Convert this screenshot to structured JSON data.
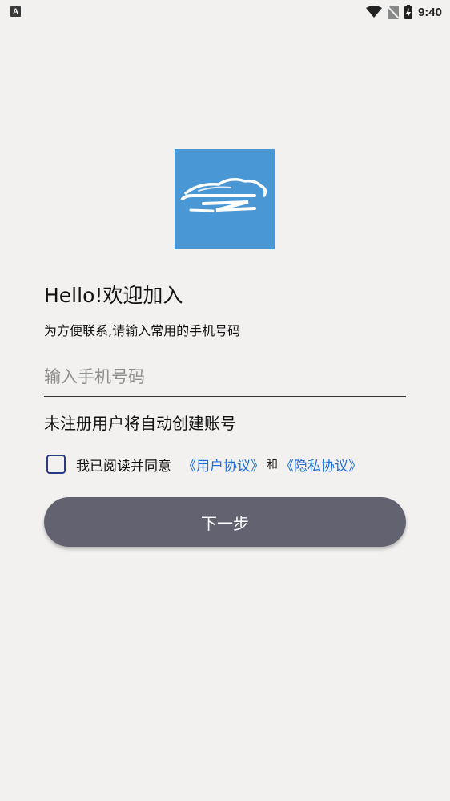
{
  "status_bar": {
    "notification_icon_letter": "A",
    "time": "9:40",
    "icons": [
      "wifi-icon",
      "no-sim-icon",
      "battery-charging-icon"
    ]
  },
  "logo": {
    "icon": "cloud-logo-icon",
    "background_color": "#4a97d6"
  },
  "header": {
    "title": "Hello!欢迎加入",
    "subtitle": "为方便联系,请输入常用的手机号码"
  },
  "form": {
    "phone_value": "",
    "phone_placeholder": "输入手机号码",
    "notice": "未注册用户将自动创建账号",
    "agreement": {
      "checked": false,
      "prefix": "我已阅读并同意",
      "user_agreement": "《用户协议》",
      "conjunction": "和",
      "privacy_policy": "《隐私协议》",
      "link_color": "#1e6fd8"
    },
    "next_label": "下一步",
    "button_color": "#636270"
  }
}
